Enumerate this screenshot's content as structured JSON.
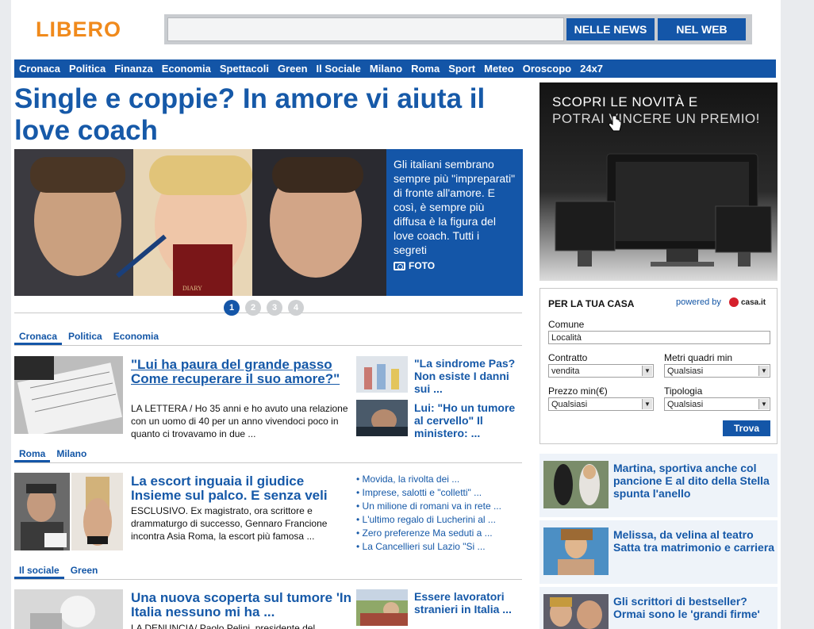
{
  "header": {
    "logo": "LIBERO",
    "search_value": "",
    "btn_news": "NELLE NEWS",
    "btn_web": "NEL WEB"
  },
  "nav": [
    "Cronaca",
    "Politica",
    "Finanza",
    "Economia",
    "Spettacoli",
    "Green",
    "Il Sociale",
    "Milano",
    "Roma",
    "Sport",
    "Meteo",
    "Oroscopo",
    "24x7"
  ],
  "hero": {
    "title": "Single e coppie? In amore vi aiuta il love coach",
    "caption": "Gli italiani sembrano sempre più \"impreparati\" di fronte all'amore. E così, è sempre più diffusa è la figura del love coach. Tutti i segreti",
    "foto_label": "FOTO",
    "book_label": "DIARY",
    "pages": [
      "1",
      "2",
      "3",
      "4"
    ],
    "active_page": "1"
  },
  "section1": {
    "tabs": [
      "Cronaca",
      "Politica",
      "Economia"
    ],
    "main_title": "\"Lui ha paura del grande passo Come recuperare il suo amore?\"",
    "main_text": "LA LETTERA / Ho 35 anni e ho avuto una relazione con un uomo di 40 per un anno vivendoci poco in quanto ci trovavamo in due ...",
    "side1": "\"La sindrome Pas? Non esiste I danni sui ...",
    "side2": "Lui: \"Ho un tumore al cervello\" Il ministero: ..."
  },
  "section2": {
    "tabs": [
      "Roma",
      "Milano"
    ],
    "main_title": "La escort inguaia il giudice Insieme sul palco. E senza veli",
    "main_text": "ESCLUSIVO. Ex magistrato, ora scrittore e drammaturgo di successo, Gennaro Francione incontra Asia Roma, la escort più famosa ...",
    "bullets": [
      "Movida, la rivolta dei ...",
      "Imprese, salotti e \"colletti\" ...",
      "Un milione di romani va in rete ...",
      "L'ultimo regalo di Lucherini al ...",
      "Zero preferenze Ma seduti a ...",
      "La Cancellieri sul Lazio \"Si ..."
    ]
  },
  "section3": {
    "tabs": [
      "Il sociale",
      "Green"
    ],
    "main_title": "Una nuova scoperta sul tumore 'In Italia nessuno mi ha ...",
    "main_text": "LA DENUNCIA/ Paolo Pelini, presidente del",
    "side1": "Essere lavoratori stranieri in Italia ..."
  },
  "ad": {
    "line1": "SCOPRI LE NOVITÀ E",
    "line2": "POTRAI VINCERE UN PREMIO!"
  },
  "casa": {
    "title": "PER LA TUA CASA",
    "powered": "powered by",
    "brand": "casa.it",
    "comune_label": "Comune",
    "comune_value": "Località",
    "contratto_label": "Contratto",
    "contratto_value": "vendita",
    "mq_label": "Metri quadri min",
    "mq_value": "Qualsiasi",
    "prezzo_label": "Prezzo min(€)",
    "prezzo_value": "Qualsiasi",
    "tipologia_label": "Tipologia",
    "tipologia_value": "Qualsiasi",
    "trova": "Trova"
  },
  "right_news": [
    "Martina, sportiva anche col pancione E al dito della Stella spunta l'anello",
    "Melissa, da velina al teatro Satta tra matrimonio e carriera",
    "Gli scrittori di bestseller? Ormai sono le 'grandi firme'"
  ],
  "colors": {
    "brand_blue": "#1456a8",
    "logo_orange": "#f08a1c"
  }
}
